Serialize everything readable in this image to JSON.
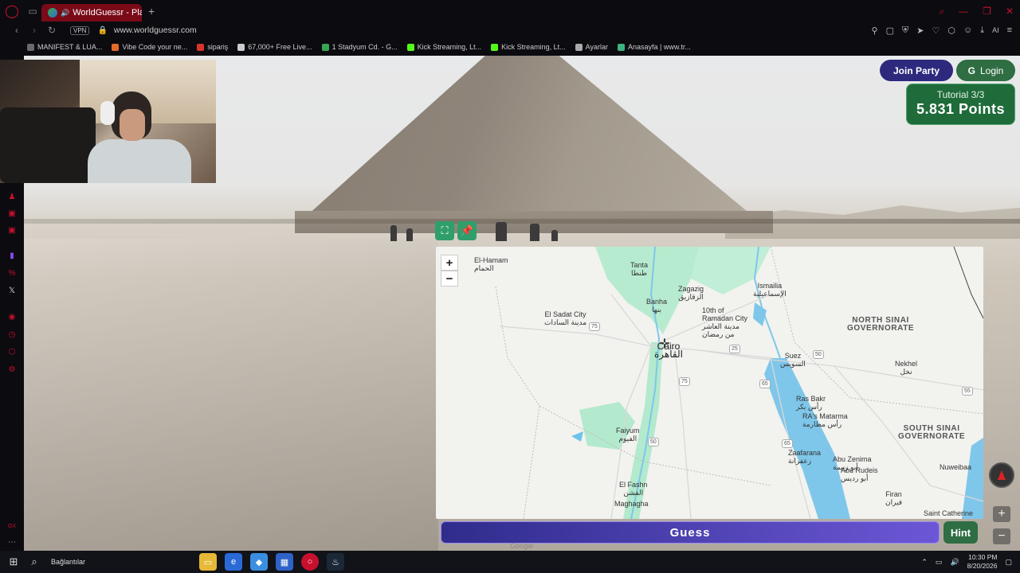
{
  "browser": {
    "tab_title": "WorldGuessr - Play Ge",
    "url": "www.worldguessr.com",
    "vpn_label": "VPN",
    "bookmarks": [
      {
        "label": "MANIFEST & LUA...",
        "color": "#6a6a6a"
      },
      {
        "label": "Vibe Code your ne...",
        "color": "#e46a2a"
      },
      {
        "label": "sipariş",
        "color": "#d9342b"
      },
      {
        "label": "67,000+ Free Live...",
        "color": "#cccccc"
      },
      {
        "label": "1 Stadyum Cd. - G...",
        "color": "#34a853"
      },
      {
        "label": "Kick Streaming, Lt...",
        "color": "#53fc18"
      },
      {
        "label": "Kick Streaming, Lt...",
        "color": "#53fc18"
      },
      {
        "label": "Ayarlar",
        "color": "#aaaaaa"
      },
      {
        "label": "Anasayfa | www.tr...",
        "color": "#3fb27f"
      }
    ]
  },
  "game": {
    "join_party": "Join Party",
    "login": "Login",
    "tutorial": "Tutorial 3/3",
    "points": "5.831 Points",
    "guess": "Guess",
    "hint": "Hint",
    "google": "Google",
    "zoom_in": "+",
    "zoom_out": "−"
  },
  "map": {
    "labels": [
      {
        "id": "tanta",
        "en": "Tanta",
        "ar": "طنطا"
      },
      {
        "id": "elhamam",
        "en": "El-Hamam",
        "ar": "الحمام"
      },
      {
        "id": "zagazig",
        "en": "Zagazig",
        "ar": "الزقازيق"
      },
      {
        "id": "ismailia",
        "en": "Ismailia",
        "ar": "الإسماعيلية"
      },
      {
        "id": "banha",
        "en": "Banha",
        "ar": "بنها"
      },
      {
        "id": "tenth",
        "en": "10th of Ramadan City",
        "ar": "مدينة العاشر من رمضان"
      },
      {
        "id": "sadat",
        "en": "El Sadat City",
        "ar": "مدينة السادات"
      },
      {
        "id": "cairo",
        "en": "Cairo",
        "ar": "القاهرة"
      },
      {
        "id": "suez",
        "en": "Suez",
        "ar": "السويس"
      },
      {
        "id": "nekhel",
        "en": "Nekhel",
        "ar": "نخل"
      },
      {
        "id": "rasbakr",
        "en": "Ras Bakr",
        "ar": "رأس بكر"
      },
      {
        "id": "rasmatarma",
        "en": "RA's Matarma",
        "ar": "رأس مطارمة"
      },
      {
        "id": "faiyum",
        "en": "Faiyum",
        "ar": "الفيوم"
      },
      {
        "id": "zaafarana",
        "en": "Zaafarana",
        "ar": "زعفرانة"
      },
      {
        "id": "abuzenima",
        "en": "Abu Zenima",
        "ar": "أبو زنيمة"
      },
      {
        "id": "abururudeis",
        "en": "Abu Rudeis",
        "ar": "أبو رديس"
      },
      {
        "id": "elfashn",
        "en": "El Fashn",
        "ar": "الفشن"
      },
      {
        "id": "maghagha",
        "en": "Maghagha",
        "ar": "مغاغة"
      },
      {
        "id": "nuweibaa",
        "en": "Nuweibaa",
        "ar": ""
      },
      {
        "id": "firan",
        "en": "Firan",
        "ar": "فيران"
      },
      {
        "id": "stcatherine",
        "en": "Saint Catherine",
        "ar": ""
      }
    ],
    "regions": [
      {
        "id": "northsinai",
        "line1": "NORTH SINAI",
        "line2": "GOVERNORATE"
      },
      {
        "id": "southsinai",
        "line1": "SOUTH SINAI",
        "line2": "GOVERNORATE"
      }
    ],
    "shields": [
      "75",
      "25",
      "50",
      "65",
      "55",
      "75",
      "65",
      "50"
    ]
  },
  "taskbar": {
    "search_text": "Bağlantılar",
    "time": "10:30 PM",
    "date": "8/20/2026"
  }
}
